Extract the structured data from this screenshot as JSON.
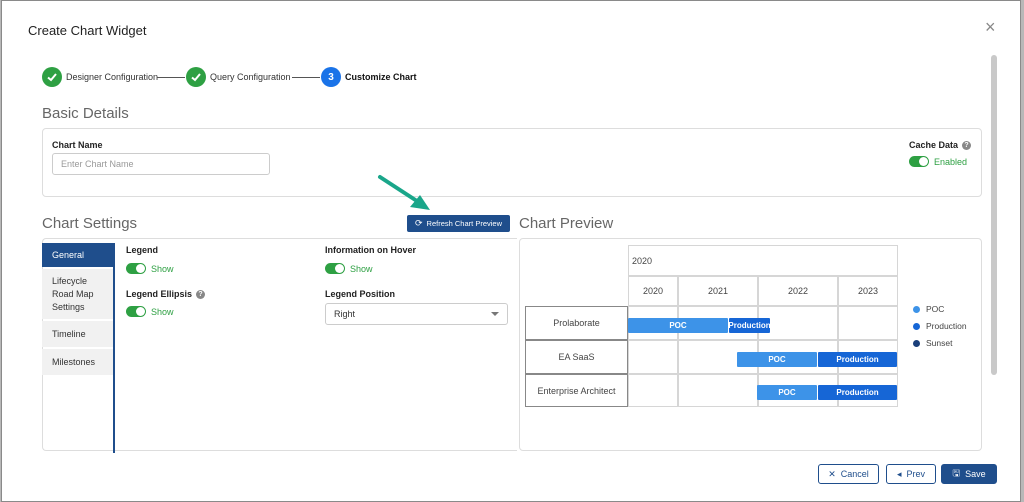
{
  "dialog": {
    "title": "Create Chart Widget",
    "close_glyph": "×"
  },
  "stepper": {
    "steps": [
      {
        "label": "Designer Configuration",
        "state": "done"
      },
      {
        "label": "Query Configuration",
        "state": "done"
      },
      {
        "label": "Customize Chart",
        "state": "active",
        "number": "3"
      }
    ]
  },
  "basic": {
    "title": "Basic Details",
    "chart_name_label": "Chart Name",
    "chart_name_placeholder": "Enter Chart Name",
    "cache_label": "Cache Data",
    "cache_state": "Enabled"
  },
  "settings": {
    "title": "Chart Settings",
    "refresh_label": "Refresh Chart Preview",
    "nav": [
      "General",
      "Lifecycle Road Map Settings",
      "Timeline",
      "Milestones"
    ],
    "active_nav": "General",
    "legend_label": "Legend",
    "legend_value": "Show",
    "ellipsis_label": "Legend Ellipsis",
    "ellipsis_value": "Show",
    "hover_label": "Information on Hover",
    "hover_value": "Show",
    "position_label": "Legend Position",
    "position_value": "Right"
  },
  "preview": {
    "title": "Chart Preview"
  },
  "chart_data": {
    "type": "gantt",
    "top_header": "2020",
    "years": [
      "2020",
      "2021",
      "2022",
      "2023"
    ],
    "rows": [
      {
        "name": "Prolaborate",
        "bars": [
          {
            "label": "POC",
            "phase": "POC"
          },
          {
            "label": "Production",
            "phase": "Production"
          }
        ]
      },
      {
        "name": "EA SaaS",
        "bars": [
          {
            "label": "POC",
            "phase": "POC"
          },
          {
            "label": "Production",
            "phase": "Production"
          }
        ]
      },
      {
        "name": "Enterprise Architect",
        "bars": [
          {
            "label": "POC",
            "phase": "POC"
          },
          {
            "label": "Production",
            "phase": "Production"
          }
        ]
      }
    ],
    "legend": [
      {
        "name": "POC",
        "color": "#3d93e8"
      },
      {
        "name": "Production",
        "color": "#1666d6"
      },
      {
        "name": "Sunset",
        "color": "#1a3f7a"
      }
    ]
  },
  "footer": {
    "cancel": "Cancel",
    "prev": "Prev",
    "save": "Save"
  },
  "colors": {
    "accent": "#1f4e8c",
    "success": "#2ea043",
    "step_active": "#1a73e8"
  }
}
